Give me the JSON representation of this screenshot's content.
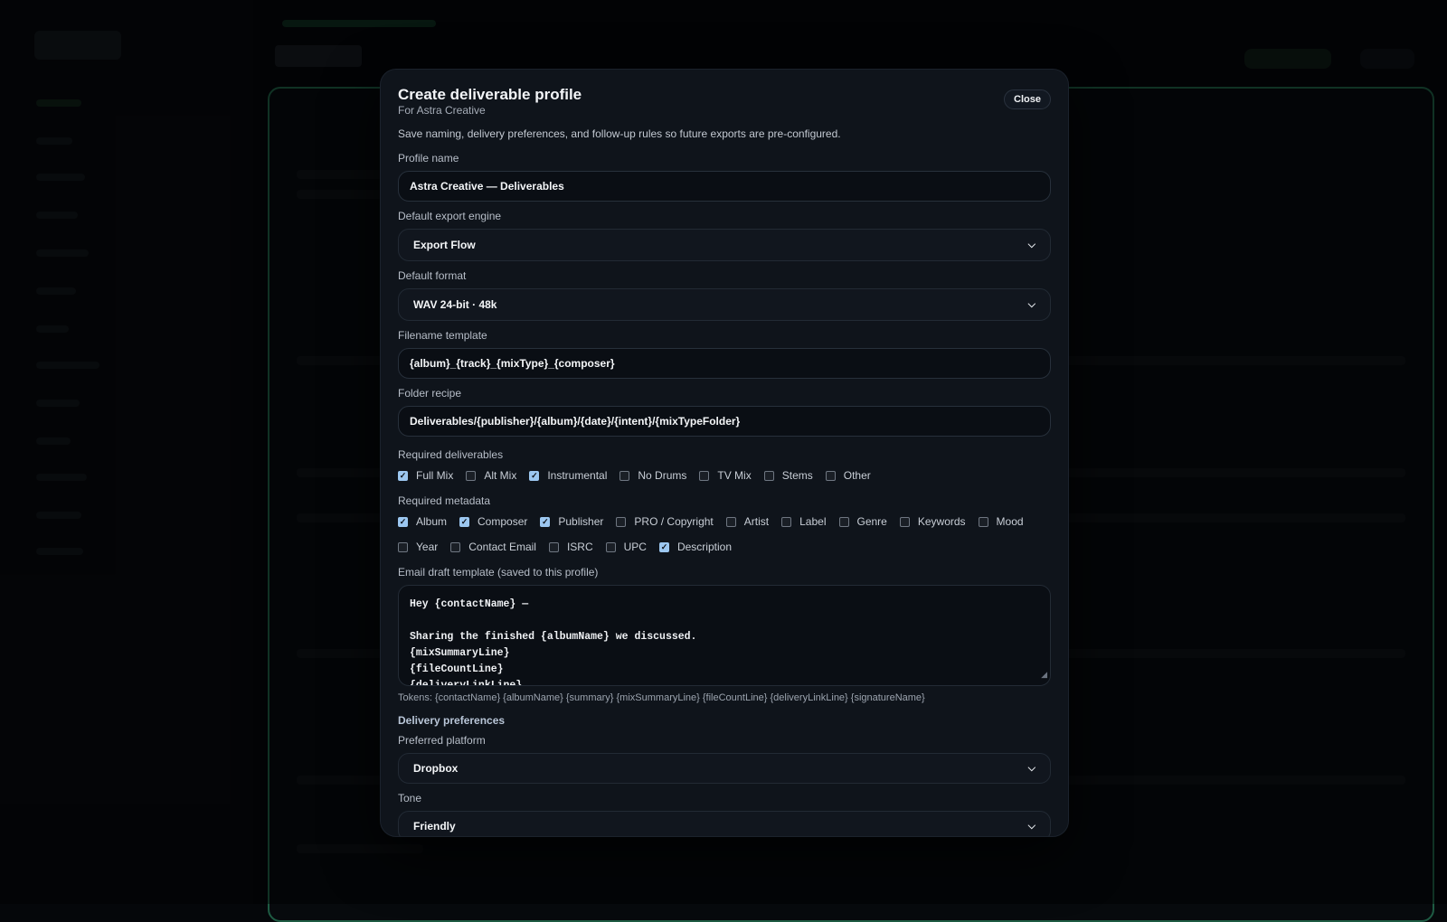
{
  "modal": {
    "title": "Create deliverable profile",
    "subtitle": "For Astra Creative",
    "description": "Save naming, delivery preferences, and follow-up rules so future exports are pre-configured.",
    "close_label": "Close"
  },
  "profile_name": {
    "label": "Profile name",
    "value": "Astra Creative — Deliverables"
  },
  "export_engine": {
    "label": "Default export engine",
    "value": "Export Flow"
  },
  "format": {
    "label": "Default format",
    "value": "WAV 24-bit · 48k"
  },
  "filename_template": {
    "label": "Filename template",
    "value": "{album}_{track}_{mixType}_{composer}"
  },
  "folder_recipe": {
    "label": "Folder recipe",
    "value": "Deliverables/{publisher}/{album}/{date}/{intent}/{mixTypeFolder}"
  },
  "deliverables": {
    "label": "Required deliverables",
    "items": [
      {
        "label": "Full Mix",
        "checked": true
      },
      {
        "label": "Alt Mix",
        "checked": false
      },
      {
        "label": "Instrumental",
        "checked": true
      },
      {
        "label": "No Drums",
        "checked": false
      },
      {
        "label": "TV Mix",
        "checked": false
      },
      {
        "label": "Stems",
        "checked": false
      },
      {
        "label": "Other",
        "checked": false
      }
    ]
  },
  "metadata": {
    "label": "Required metadata",
    "items": [
      {
        "label": "Album",
        "checked": true
      },
      {
        "label": "Composer",
        "checked": true
      },
      {
        "label": "Publisher",
        "checked": true
      },
      {
        "label": "PRO / Copyright",
        "checked": false
      },
      {
        "label": "Artist",
        "checked": false
      },
      {
        "label": "Label",
        "checked": false
      },
      {
        "label": "Genre",
        "checked": false
      },
      {
        "label": "Keywords",
        "checked": false
      },
      {
        "label": "Mood",
        "checked": false
      },
      {
        "label": "Year",
        "checked": false
      },
      {
        "label": "Contact Email",
        "checked": false
      },
      {
        "label": "ISRC",
        "checked": false
      },
      {
        "label": "UPC",
        "checked": false
      },
      {
        "label": "Description",
        "checked": true
      }
    ]
  },
  "email_template": {
    "label": "Email draft template (saved to this profile)",
    "value": "Hey {contactName} —\n\nSharing the finished {albumName} we discussed.\n{mixSummaryLine}\n{fileCountLine}\n{deliveryLinkLine}",
    "tokens": "Tokens: {contactName} {albumName} {summary} {mixSummaryLine} {fileCountLine} {deliveryLinkLine} {signatureName}"
  },
  "delivery": {
    "section_title": "Delivery preferences",
    "platform_label": "Preferred platform",
    "platform_value": "Dropbox",
    "tone_label": "Tone",
    "tone_value": "Friendly"
  },
  "colors": {
    "accent": "#9cc7f0",
    "panel_border": "#1e5b43",
    "modal_bg": "#0f141b"
  },
  "icons": {
    "select": "chevron-down-icon",
    "check": "check-icon"
  }
}
